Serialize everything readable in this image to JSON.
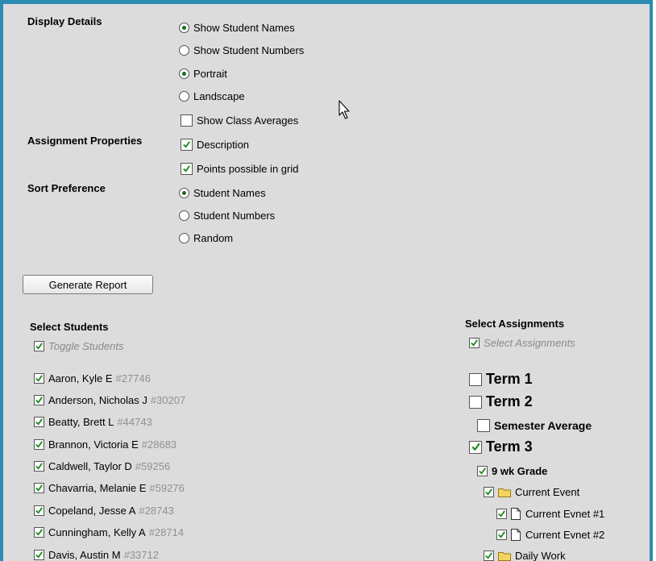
{
  "display": {
    "heading": "Display Details",
    "show_names": "Show Student Names",
    "show_numbers": "Show Student Numbers",
    "portrait": "Portrait",
    "landscape": "Landscape",
    "class_averages": "Show Class Averages"
  },
  "assignment_props": {
    "heading": "Assignment Properties",
    "description": "Description",
    "points": "Points possible in grid"
  },
  "sort": {
    "heading": "Sort Preference",
    "names": "Student Names",
    "numbers": "Student Numbers",
    "random": "Random"
  },
  "generate_label": "Generate Report",
  "students": {
    "heading": "Select Students",
    "toggle": "Toggle Students",
    "items": [
      {
        "name": "Aaron, Kyle E",
        "num": "#27746"
      },
      {
        "name": "Anderson, Nicholas J",
        "num": "#30207"
      },
      {
        "name": "Beatty, Brett L",
        "num": "#44743"
      },
      {
        "name": "Brannon, Victoria E",
        "num": "#28683"
      },
      {
        "name": "Caldwell, Taylor D",
        "num": "#59256"
      },
      {
        "name": "Chavarria, Melanie E",
        "num": "#59276"
      },
      {
        "name": "Copeland, Jesse A",
        "num": "#28743"
      },
      {
        "name": "Cunningham, Kelly A",
        "num": "#28714"
      },
      {
        "name": "Davis, Austin M",
        "num": "#33712"
      }
    ]
  },
  "assignments": {
    "heading": "Select Assignments",
    "toggle": "Select Assignments",
    "term1": "Term 1",
    "term2": "Term 2",
    "semester": "Semester Average",
    "term3": "Term 3",
    "wk_grade": "9 wk Grade",
    "current_event": "Current Event",
    "evnet1": "Current Evnet #1",
    "evnet2": "Current Evnet #2",
    "daily_work": "Daily Work"
  },
  "colors": {
    "frame": "#2c8bb0",
    "check": "#1a8a1a",
    "panel": "#dcdcdc"
  }
}
